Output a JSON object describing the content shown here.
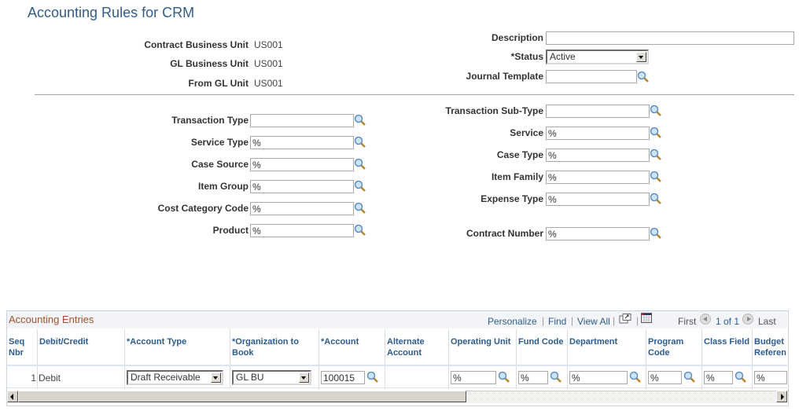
{
  "page": {
    "title": "Accounting Rules for CRM"
  },
  "header": {
    "contract_bu_label": "Contract Business Unit",
    "contract_bu_value": "US001",
    "gl_bu_label": "GL Business Unit",
    "gl_bu_value": "US001",
    "from_gl_label": "From GL Unit",
    "from_gl_value": "US001",
    "description_label": "Description",
    "description_value": "",
    "status_label": "*Status",
    "status_value": "Active",
    "journal_template_label": "Journal Template",
    "journal_template_value": ""
  },
  "criteria": {
    "left": [
      {
        "label": "Transaction Type",
        "value": ""
      },
      {
        "label": "Service Type",
        "value": "%"
      },
      {
        "label": "Case Source",
        "value": "%"
      },
      {
        "label": "Item Group",
        "value": "%"
      },
      {
        "label": "Cost Category Code",
        "value": "%"
      },
      {
        "label": "Product",
        "value": "%"
      }
    ],
    "right": [
      {
        "label": "Transaction Sub-Type",
        "value": ""
      },
      {
        "label": "Service",
        "value": "%"
      },
      {
        "label": "Case Type",
        "value": "%"
      },
      {
        "label": "Item Family",
        "value": "%"
      },
      {
        "label": "Expense Type",
        "value": "%"
      },
      {
        "label": "Contract Number",
        "value": "%"
      }
    ]
  },
  "grid": {
    "title": "Accounting Entries",
    "personalize": "Personalize",
    "find": "Find",
    "view_all": "View All",
    "first": "First",
    "pager": "1 of 1",
    "last": "Last",
    "columns": [
      "Seq Nbr",
      "Debit/Credit",
      "*Account Type",
      "*Organization to Book",
      "*Account",
      "Alternate Account",
      "Operating Unit",
      "Fund Code",
      "Department",
      "Program Code",
      "Class Field",
      "Budget Reference"
    ],
    "row": {
      "seq": "1",
      "debit_credit": "Debit",
      "account_type": "Draft Receivable",
      "org_to_book": "GL BU",
      "account": "100015",
      "alternate_account": "",
      "operating_unit": "%",
      "fund_code": "%",
      "department": "%",
      "program_code": "%",
      "class_field": "%",
      "budget_reference": "%"
    }
  }
}
